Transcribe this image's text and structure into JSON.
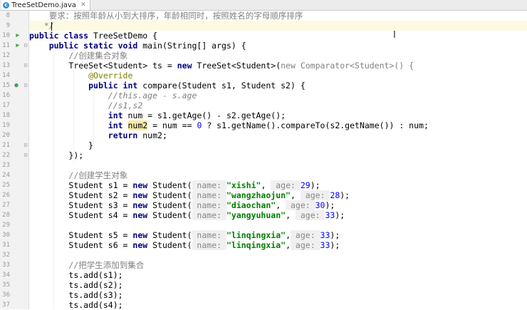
{
  "tab": {
    "filename": "TreeSetDemo.java",
    "icon": "java-class-icon"
  },
  "gutter": {
    "line_numbers": [
      "8",
      "9",
      "10",
      "11",
      "12",
      "13",
      "14",
      "15",
      "16",
      "17",
      "18",
      "19",
      "20",
      "21",
      "22",
      "23",
      "24",
      "25",
      "26",
      "27",
      "28",
      "29",
      "30",
      "31",
      "32",
      "33",
      "34",
      "35",
      "36",
      "37"
    ]
  },
  "code": {
    "l8": {
      "cmt": "要求：按照年龄从小到大排序，年龄相同时，按照姓名的字母顺序排序"
    },
    "l9": {
      "cmt": "*/"
    },
    "l10": {
      "kw1": "public class",
      "t1": " TreeSetDemo {"
    },
    "l11": {
      "kw1": "public static void",
      "t1": " main(String[] args) {"
    },
    "l12": {
      "cmt": "//创建集合对象"
    },
    "l13": {
      "t1": "TreeSet<Student> ts = ",
      "kw1": "new",
      "t2": " TreeSet<Student>(",
      "g1": "new Comparator<Student>() {"
    },
    "l14": {
      "ann": "@Override"
    },
    "l15": {
      "kw1": "public int",
      "t1": " compare(Student s1, Student s2) {"
    },
    "l16": {
      "icmt": "//this.age - s.age"
    },
    "l17": {
      "icmt": "//s1,s2"
    },
    "l18": {
      "kw1": "int",
      "t1": " num = s1.getAge() - s2.getAge();"
    },
    "l19": {
      "kw1": "int",
      "hl": "num2",
      "t1": " = num == ",
      "num": "0",
      "t2": " ? s1.getName().compareTo(s2.getName()) : num;"
    },
    "l20": {
      "kw1": "return",
      "t1": " num2;"
    },
    "l21": {
      "t1": "}"
    },
    "l22": {
      "t1": "});"
    },
    "l24": {
      "cmt": "//创建学生对象"
    },
    "students": [
      {
        "line": "l25",
        "var": "Student s1 = ",
        "kw": "new",
        "ctor": " Student(",
        "h1": " name: ",
        "name": "\"xishi\"",
        "sep": ", ",
        "h2": " age: ",
        "age": "29",
        "end": ");"
      },
      {
        "line": "l26",
        "var": "Student s2 = ",
        "kw": "new",
        "ctor": " Student(",
        "h1": " name: ",
        "name": "\"wangzhaojun\"",
        "sep": ", ",
        "h2": " age: ",
        "age": "28",
        "end": ");"
      },
      {
        "line": "l27",
        "var": "Student s3 = ",
        "kw": "new",
        "ctor": " Student(",
        "h1": " name: ",
        "name": "\"diaochan\"",
        "sep": ", ",
        "h2": " age: ",
        "age": "30",
        "end": ");"
      },
      {
        "line": "l28",
        "var": "Student s4 = ",
        "kw": "new",
        "ctor": " Student(",
        "h1": " name: ",
        "name": "\"yangyuhuan\"",
        "sep": ", ",
        "h2": " age: ",
        "age": "33",
        "end": ");"
      },
      {
        "line": "l30",
        "var": "Student s5 = ",
        "kw": "new",
        "ctor": " Student(",
        "h1": " name: ",
        "name": "\"linqingxia\"",
        "sep": ",",
        "h2": " age: ",
        "age": "33",
        "end": ");"
      },
      {
        "line": "l31",
        "var": "Student s6 = ",
        "kw": "new",
        "ctor": " Student(",
        "h1": " name: ",
        "name": "\"linqingxia\"",
        "sep": ",",
        "h2": " age: ",
        "age": "33",
        "end": ");"
      }
    ],
    "l33": {
      "cmt": "//把学生添加到集合"
    },
    "l34": {
      "t1": "ts.add(s1);"
    },
    "l35": {
      "t1": "ts.add(s2);"
    },
    "l36": {
      "t1": "ts.add(s3);"
    },
    "l37": {
      "t1": "ts.add(s4);"
    }
  },
  "colors": {
    "keyword": "#000080",
    "string": "#008000",
    "number": "#0000ff",
    "comment": "#808080",
    "annotation": "#808000",
    "current_line": "#fcfae1"
  }
}
